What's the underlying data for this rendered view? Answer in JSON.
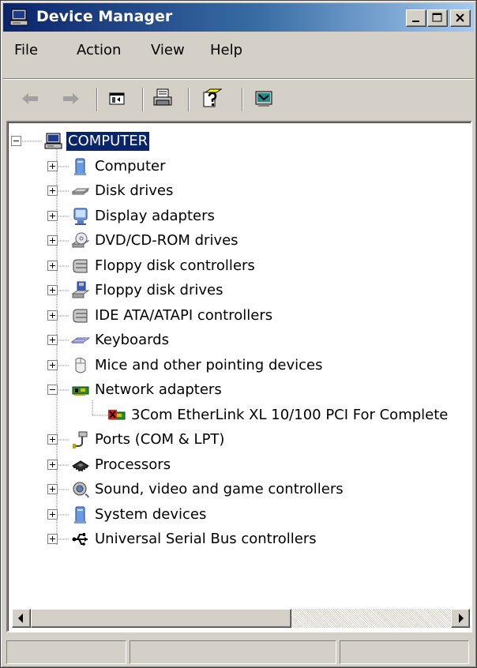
{
  "window": {
    "title": "Device Manager",
    "title_icon": "computer-icon",
    "controls": {
      "minimize": "minimize-icon",
      "maximize": "maximize-icon",
      "close": "close-icon"
    }
  },
  "menu": {
    "items": [
      {
        "label": "File"
      },
      {
        "label": "Action"
      },
      {
        "label": "View"
      },
      {
        "label": "Help"
      }
    ]
  },
  "toolbar": {
    "buttons": [
      "back-arrow-icon",
      "forward-arrow-icon",
      "show-hide-console-tree-icon",
      "print-icon",
      "help-icon",
      "scan-hardware-icon"
    ]
  },
  "tree": {
    "root": {
      "label": "COMPUTER",
      "icon": "computer-icon",
      "expanded": true,
      "selected": true
    },
    "categories": [
      {
        "label": "Computer",
        "icon": "computer-icon",
        "expanded": false
      },
      {
        "label": "Disk drives",
        "icon": "disk-drive-icon",
        "expanded": false
      },
      {
        "label": "Display adapters",
        "icon": "display-adapter-icon",
        "expanded": false
      },
      {
        "label": "DVD/CD-ROM drives",
        "icon": "cdrom-icon",
        "expanded": false
      },
      {
        "label": "Floppy disk controllers",
        "icon": "controller-icon",
        "expanded": false
      },
      {
        "label": "Floppy disk drives",
        "icon": "floppy-drive-icon",
        "expanded": false
      },
      {
        "label": "IDE ATA/ATAPI controllers",
        "icon": "controller-icon",
        "expanded": false
      },
      {
        "label": "Keyboards",
        "icon": "keyboard-icon",
        "expanded": false
      },
      {
        "label": "Mice and other pointing devices",
        "icon": "mouse-icon",
        "expanded": false
      },
      {
        "label": "Network adapters",
        "icon": "network-adapter-icon",
        "expanded": true,
        "children": [
          {
            "label": "3Com EtherLink XL 10/100 PCI For Complete",
            "icon": "network-adapter-disabled-icon"
          }
        ]
      },
      {
        "label": "Ports (COM & LPT)",
        "icon": "port-icon",
        "expanded": false
      },
      {
        "label": "Processors",
        "icon": "processor-icon",
        "expanded": false
      },
      {
        "label": "Sound, video and game controllers",
        "icon": "sound-icon",
        "expanded": false
      },
      {
        "label": "System devices",
        "icon": "computer-icon",
        "expanded": false
      },
      {
        "label": "Universal Serial Bus controllers",
        "icon": "usb-icon",
        "expanded": false
      }
    ]
  },
  "statusbar": {
    "panes": [
      "",
      "",
      ""
    ]
  },
  "colors": {
    "title_gradient_start": "#0a246a",
    "title_gradient_end": "#a6caf0",
    "selection": "#0a246a",
    "face": "#d4d0c8"
  }
}
